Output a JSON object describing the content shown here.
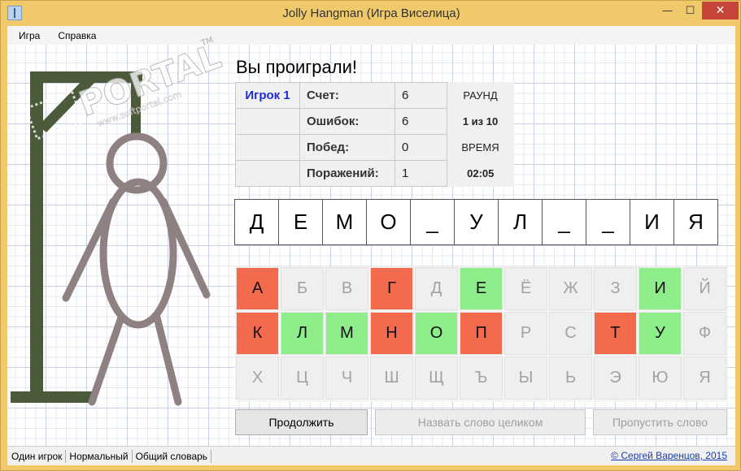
{
  "window": {
    "title": "Jolly Hangman (Игра Виселица)"
  },
  "menu": {
    "items": [
      "Игра",
      "Справка"
    ]
  },
  "game": {
    "result": "Вы проиграли!",
    "player": "Игрок 1",
    "stats": [
      {
        "label": "Счет:",
        "value": "6"
      },
      {
        "label": "Ошибок:",
        "value": "6"
      },
      {
        "label": "Побед:",
        "value": "0"
      },
      {
        "label": "Поражений:",
        "value": "1"
      }
    ],
    "round_label": "РАУНД",
    "round_value": "1 из 10",
    "time_label": "ВРЕМЯ",
    "time_value": "02:05"
  },
  "word": [
    "Д",
    "Е",
    "М",
    "О",
    "_",
    "У",
    "Л",
    "_",
    "_",
    "И",
    "Я"
  ],
  "keyboard": [
    {
      "letter": "А",
      "state": "wrong"
    },
    {
      "letter": "Б",
      "state": "unused"
    },
    {
      "letter": "В",
      "state": "unused"
    },
    {
      "letter": "Г",
      "state": "wrong"
    },
    {
      "letter": "Д",
      "state": "unused"
    },
    {
      "letter": "Е",
      "state": "right"
    },
    {
      "letter": "Ё",
      "state": "unused"
    },
    {
      "letter": "Ж",
      "state": "unused"
    },
    {
      "letter": "З",
      "state": "unused"
    },
    {
      "letter": "И",
      "state": "right"
    },
    {
      "letter": "Й",
      "state": "unused"
    },
    {
      "letter": "К",
      "state": "wrong"
    },
    {
      "letter": "Л",
      "state": "right"
    },
    {
      "letter": "М",
      "state": "right"
    },
    {
      "letter": "Н",
      "state": "wrong"
    },
    {
      "letter": "О",
      "state": "right"
    },
    {
      "letter": "П",
      "state": "wrong"
    },
    {
      "letter": "Р",
      "state": "unused"
    },
    {
      "letter": "С",
      "state": "unused"
    },
    {
      "letter": "Т",
      "state": "wrong"
    },
    {
      "letter": "У",
      "state": "right"
    },
    {
      "letter": "Ф",
      "state": "unused"
    },
    {
      "letter": "Х",
      "state": "unused"
    },
    {
      "letter": "Ц",
      "state": "unused"
    },
    {
      "letter": "Ч",
      "state": "unused"
    },
    {
      "letter": "Ш",
      "state": "unused"
    },
    {
      "letter": "Щ",
      "state": "unused"
    },
    {
      "letter": "Ъ",
      "state": "unused"
    },
    {
      "letter": "Ы",
      "state": "unused"
    },
    {
      "letter": "Ь",
      "state": "unused"
    },
    {
      "letter": "Э",
      "state": "unused"
    },
    {
      "letter": "Ю",
      "state": "unused"
    },
    {
      "letter": "Я",
      "state": "unused"
    }
  ],
  "buttons": {
    "continue": "Продолжить",
    "guess_word": "Назвать слово целиком",
    "skip_word": "Пропустить слово"
  },
  "status": {
    "mode": "Один игрок",
    "difficulty": "Нормальный",
    "dictionary": "Общий словарь",
    "copyright": "© Сергей Варенцов, 2015"
  },
  "watermark": {
    "text": "PORTAL",
    "url": "www.softportal.com",
    "tm": "TM"
  },
  "colors": {
    "wrong": "#f46a4c",
    "right": "#8ded8b",
    "gallows": "#4b5a3b",
    "figure": "#8f8182"
  }
}
